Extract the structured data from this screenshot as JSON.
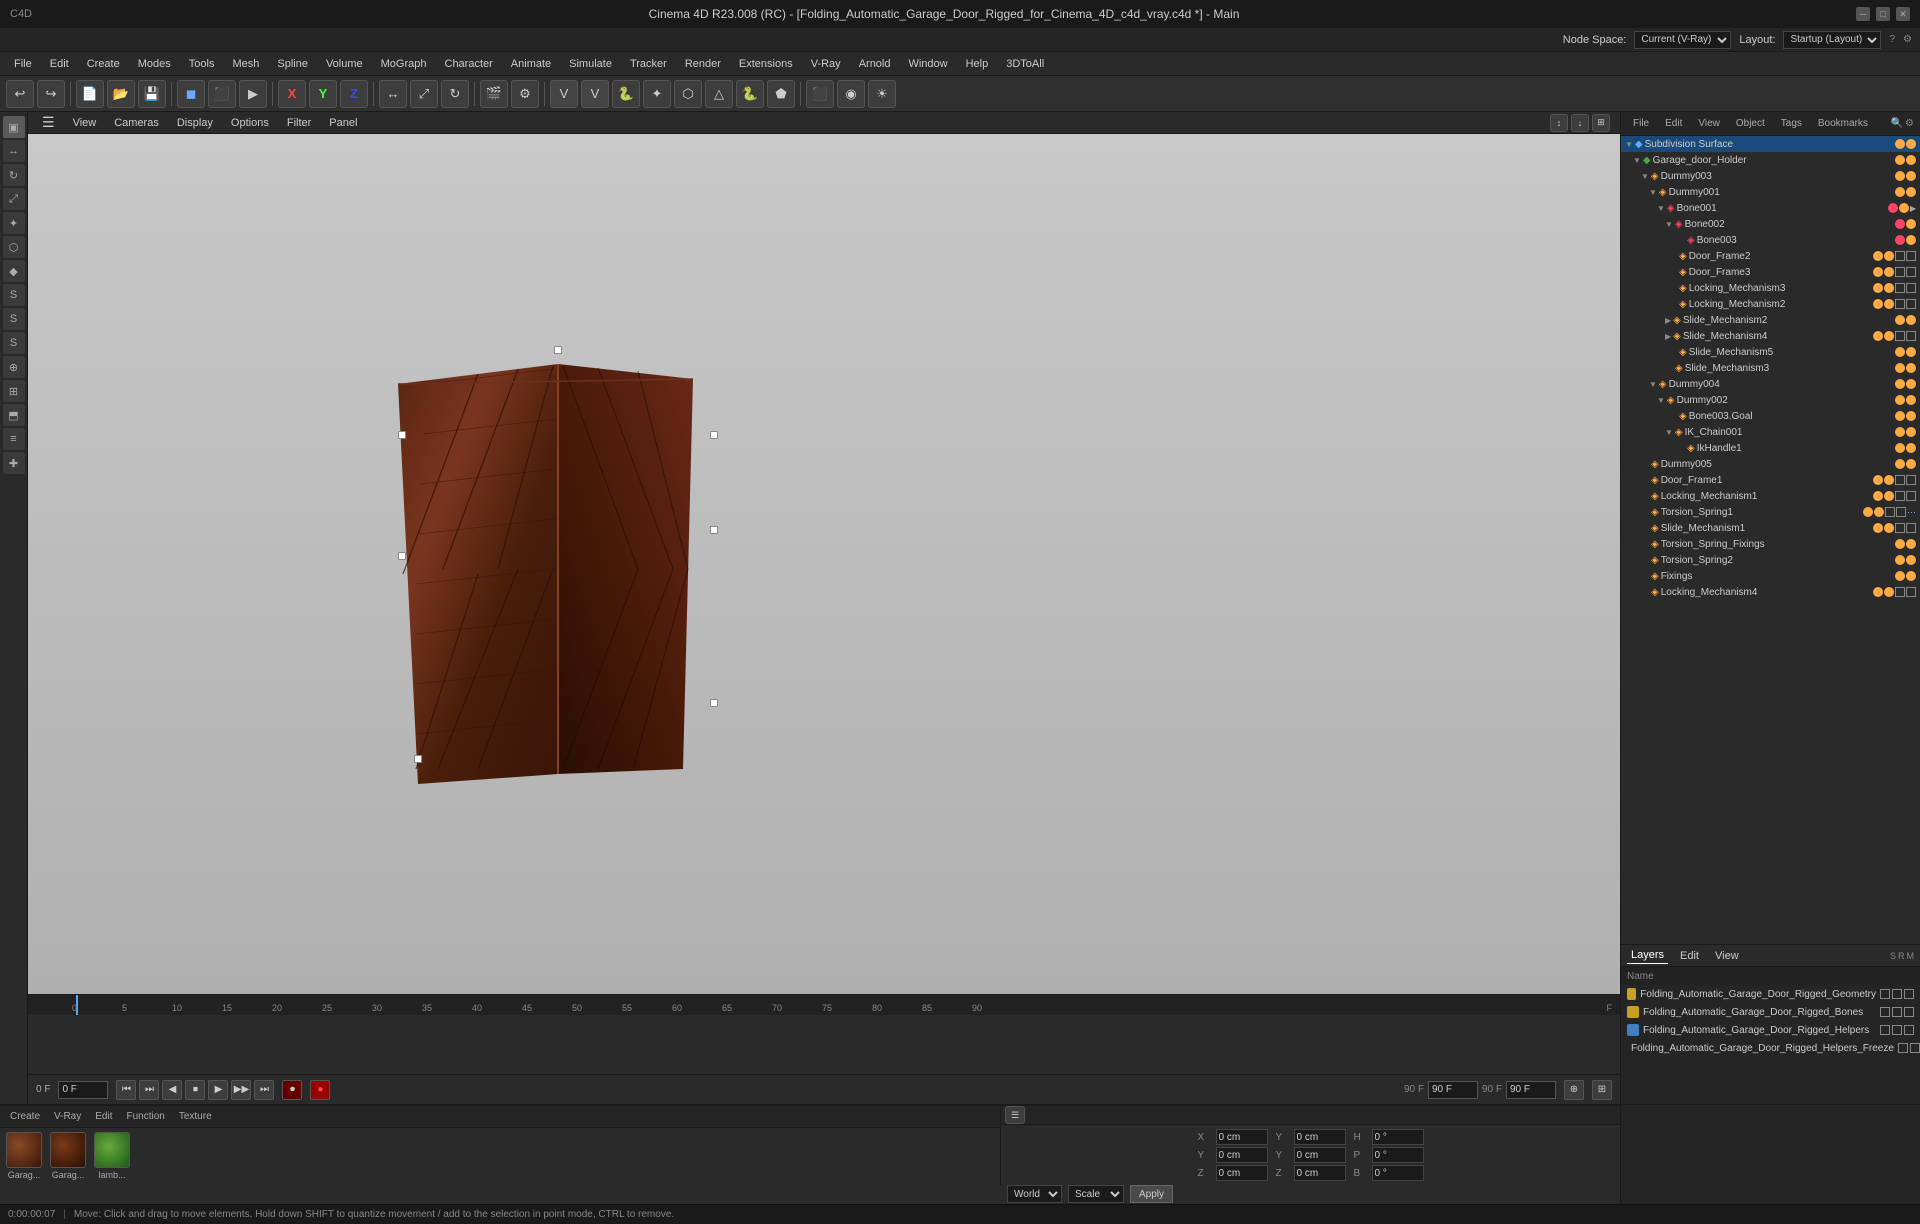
{
  "titleBar": {
    "title": "Cinema 4D R23.008 (RC) - [Folding_Automatic_Garage_Door_Rigged_for_Cinema_4D_c4d_vray.c4d *] - Main",
    "controls": [
      "─",
      "□",
      "✕"
    ]
  },
  "globalTopBar": {
    "nodeSpaceLabel": "Node Space:",
    "nodeSpaceValue": "Current (V-Ray)",
    "layoutLabel": "Layout:",
    "layoutValue": "Startup (Layout)"
  },
  "menuBar": {
    "items": [
      "File",
      "Edit",
      "Create",
      "Modes",
      "Tools",
      "Mesh",
      "Spline",
      "Volume",
      "MoGraph",
      "Character",
      "Animate",
      "Simulate",
      "Tracker",
      "Render",
      "Extensions",
      "V-Ray",
      "Arnold",
      "Window",
      "Help",
      "3DToAll"
    ]
  },
  "viewportMenu": {
    "items": [
      "View",
      "Cameras",
      "Display",
      "Options",
      "Filter",
      "Panel"
    ]
  },
  "rightTopBar": {
    "items": [
      "File",
      "Edit",
      "View",
      "Object",
      "Tags",
      "Bookmarks"
    ]
  },
  "objectHierarchy": {
    "items": [
      {
        "name": "Subdivision Surface",
        "level": 0,
        "icon": "◆",
        "color": "#6af",
        "hasChildren": true,
        "expanded": true
      },
      {
        "name": "Garage_door_Holder",
        "level": 1,
        "icon": "◆",
        "color": "#4a4",
        "hasChildren": true,
        "expanded": true
      },
      {
        "name": "Dummy003",
        "level": 2,
        "icon": "◈",
        "color": "#fa4",
        "hasChildren": true,
        "expanded": true
      },
      {
        "name": "Dummy001",
        "level": 3,
        "icon": "◈",
        "color": "#fa4",
        "hasChildren": true,
        "expanded": true
      },
      {
        "name": "Bone001",
        "level": 4,
        "icon": "◈",
        "color": "#f46",
        "hasChildren": true,
        "expanded": true
      },
      {
        "name": "Bone002",
        "level": 5,
        "icon": "◈",
        "color": "#f46",
        "hasChildren": true,
        "expanded": true
      },
      {
        "name": "Bone003",
        "level": 6,
        "icon": "◈",
        "color": "#f46",
        "hasChildren": false
      },
      {
        "name": "Door_Frame2",
        "level": 5,
        "icon": "◈",
        "color": "#fa4",
        "hasChildren": false
      },
      {
        "name": "Door_Frame3",
        "level": 5,
        "icon": "◈",
        "color": "#fa4",
        "hasChildren": false
      },
      {
        "name": "Locking_Mechanism3",
        "level": 5,
        "icon": "◈",
        "color": "#fa4",
        "hasChildren": false
      },
      {
        "name": "Locking_Mechanism2",
        "level": 5,
        "icon": "◈",
        "color": "#fa4",
        "hasChildren": false
      },
      {
        "name": "Slide_Mechanism2",
        "level": 5,
        "icon": "◈",
        "color": "#fa4",
        "hasChildren": false
      },
      {
        "name": "Slide_Mechanism4",
        "level": 5,
        "icon": "◈",
        "color": "#fa4",
        "hasChildren": true,
        "expanded": false
      },
      {
        "name": "Slide_Mechanism5",
        "level": 5,
        "icon": "◈",
        "color": "#fa4",
        "hasChildren": false
      },
      {
        "name": "Slide_Mechanism3",
        "level": 5,
        "icon": "◈",
        "color": "#fa4",
        "hasChildren": false
      },
      {
        "name": "Dummy004",
        "level": 3,
        "icon": "◈",
        "color": "#fa4",
        "hasChildren": true,
        "expanded": true
      },
      {
        "name": "Dummy002",
        "level": 4,
        "icon": "◈",
        "color": "#fa4",
        "hasChildren": true,
        "expanded": true
      },
      {
        "name": "Bone003.Goal",
        "level": 5,
        "icon": "◈",
        "color": "#fa4",
        "hasChildren": false
      },
      {
        "name": "IK_Chain001",
        "level": 5,
        "icon": "◈",
        "color": "#fa4",
        "hasChildren": true,
        "expanded": true
      },
      {
        "name": "IkHandle1",
        "level": 6,
        "icon": "◈",
        "color": "#fa4",
        "hasChildren": false
      },
      {
        "name": "Dummy005",
        "level": 2,
        "icon": "◈",
        "color": "#fa4",
        "hasChildren": false
      },
      {
        "name": "Door_Frame1",
        "level": 2,
        "icon": "◈",
        "color": "#fa4",
        "hasChildren": false
      },
      {
        "name": "Locking_Mechanism1",
        "level": 2,
        "icon": "◈",
        "color": "#fa4",
        "hasChildren": false
      },
      {
        "name": "Torsion_Spring1",
        "level": 2,
        "icon": "◈",
        "color": "#fa4",
        "hasChildren": false
      },
      {
        "name": "Slide_Mechanism1",
        "level": 2,
        "icon": "◈",
        "color": "#fa4",
        "hasChildren": false
      },
      {
        "name": "Torsion_Spring_Fixings",
        "level": 2,
        "icon": "◈",
        "color": "#fa4",
        "hasChildren": false
      },
      {
        "name": "Torsion_Spring2",
        "level": 2,
        "icon": "◈",
        "color": "#fa4",
        "hasChildren": false
      },
      {
        "name": "Fixings",
        "level": 2,
        "icon": "◈",
        "color": "#fa4",
        "hasChildren": false
      },
      {
        "name": "Locking_Mechanism4",
        "level": 2,
        "icon": "◈",
        "color": "#fa4",
        "hasChildren": false
      }
    ]
  },
  "layersPanel": {
    "tabs": [
      "Layers",
      "Edit",
      "View"
    ],
    "activeTab": "Layers",
    "layers": [
      {
        "name": "Folding_Automatic_Garage_Door_Rigged_Geometry",
        "color": "#c8a020"
      },
      {
        "name": "Folding_Automatic_Garage_Door_Rigged_Bones",
        "color": "#c8a020"
      },
      {
        "name": "Folding_Automatic_Garage_Door_Rigged_Helpers",
        "color": "#4080c0"
      },
      {
        "name": "Folding_Automatic_Garage_Door_Rigged_Helpers_Freeze",
        "color": "#c8a020"
      }
    ],
    "nameColumnHeader": "Name",
    "sColumn": "S",
    "rColumn": "R",
    "mColumn": "M"
  },
  "timeline": {
    "currentFrame": "0",
    "endFrame": "90 F",
    "totalFrames": "90 F",
    "markers": [
      "0",
      "5",
      "10",
      "15",
      "20",
      "25",
      "30",
      "35",
      "40",
      "45",
      "50",
      "55",
      "60",
      "65",
      "70",
      "75",
      "80",
      "85",
      "90"
    ]
  },
  "playback": {
    "buttons": [
      "⏮",
      "⏭",
      "◀",
      "▶",
      "⏹",
      "▶▶",
      "⏭"
    ]
  },
  "frameFields": {
    "currentLabel": "0 F",
    "currentValue": "0 F",
    "endLabel": "90 F",
    "totalLabel": "90 F"
  },
  "transform": {
    "xLabel": "X",
    "yLabel": "Y",
    "zLabel": "Z",
    "xPos": "0 cm",
    "yPos": "0 cm",
    "zPos": "0 cm",
    "xScale": "0 cm",
    "yScale": "0 cm",
    "zScale": "0 cm",
    "hRot": "0 °",
    "pRot": "0 °",
    "bRot": "0 °",
    "coordinateSystem": "World",
    "mode": "Scale",
    "applyLabel": "Apply"
  },
  "materialBar": {
    "menuItems": [
      "Create",
      "V-Ray",
      "Edit",
      "Function",
      "Texture"
    ],
    "materials": [
      {
        "name": "Garag...",
        "color": "#7a3a20"
      },
      {
        "name": "Garag...",
        "color": "#6a3018"
      },
      {
        "name": "lamb...",
        "color": "#3a8a3a"
      }
    ]
  },
  "statusBar": {
    "time": "0:00:00:07",
    "message": "Move: Click and drag to move elements. Hold down SHIFT to quantize movement / add to the selection in point mode, CTRL to remove."
  },
  "icons": {
    "move": "↔",
    "select": "▣",
    "rotate": "↻",
    "scale": "⤢",
    "undo": "↩",
    "redo": "↪",
    "new": "📄",
    "open": "📂",
    "save": "💾"
  }
}
